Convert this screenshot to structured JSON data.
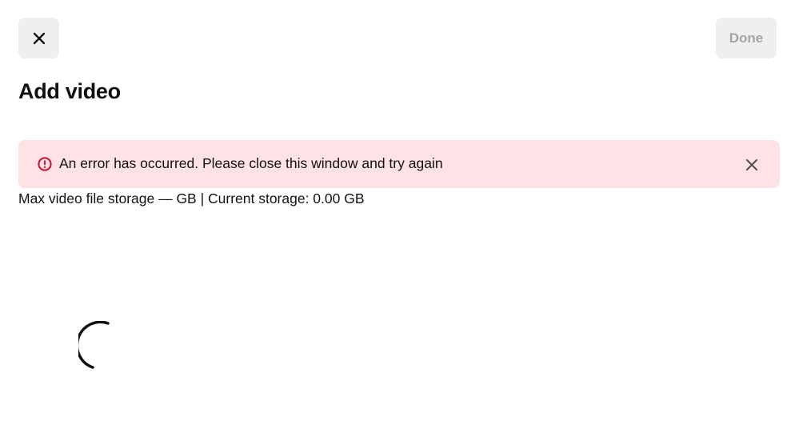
{
  "header": {
    "close_icon": "close-icon",
    "done_label": "Done"
  },
  "page": {
    "title": "Add video"
  },
  "error": {
    "icon": "exclamation-circle-icon",
    "message": "An error has occurred. Please close this window and try again",
    "dismiss_icon": "close-icon",
    "color": "#c8102e",
    "background": "#ffe2e6"
  },
  "storage": {
    "text": "Max video file storage — GB | Current storage: 0.00 GB"
  },
  "loading": {
    "icon": "loading-spinner-icon"
  }
}
